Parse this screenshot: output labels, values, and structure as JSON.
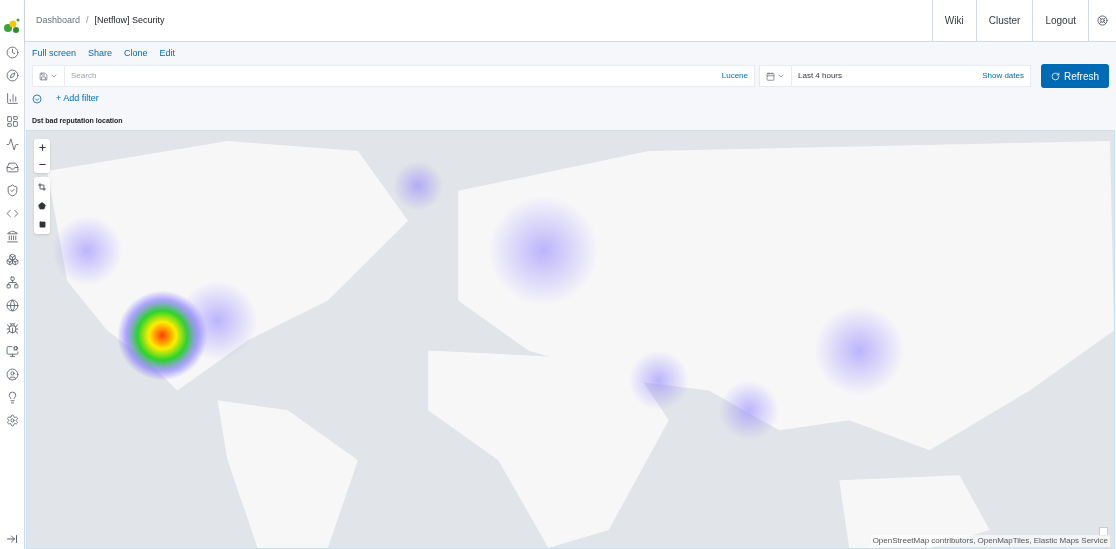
{
  "breadcrumbs": [
    {
      "label": "Dashboard",
      "selected": false
    },
    {
      "label": "[Netflow] Security",
      "selected": true
    }
  ],
  "breadcrumb_separator": "/",
  "header_links": [
    "Wiki",
    "Cluster",
    "Logout"
  ],
  "top_nav": [
    "Full screen",
    "Share",
    "Clone",
    "Edit"
  ],
  "search": {
    "placeholder": "Search",
    "language": "Lucene"
  },
  "time": {
    "value": "Last 4 hours",
    "show_dates": "Show dates"
  },
  "refresh_button": "Refresh",
  "add_filter": "+ Add filter",
  "panel": {
    "title": "Dst bad reputation location",
    "attribution": "OpenStreetMap contributors, OpenMapTiles, Elastic Maps Service"
  }
}
